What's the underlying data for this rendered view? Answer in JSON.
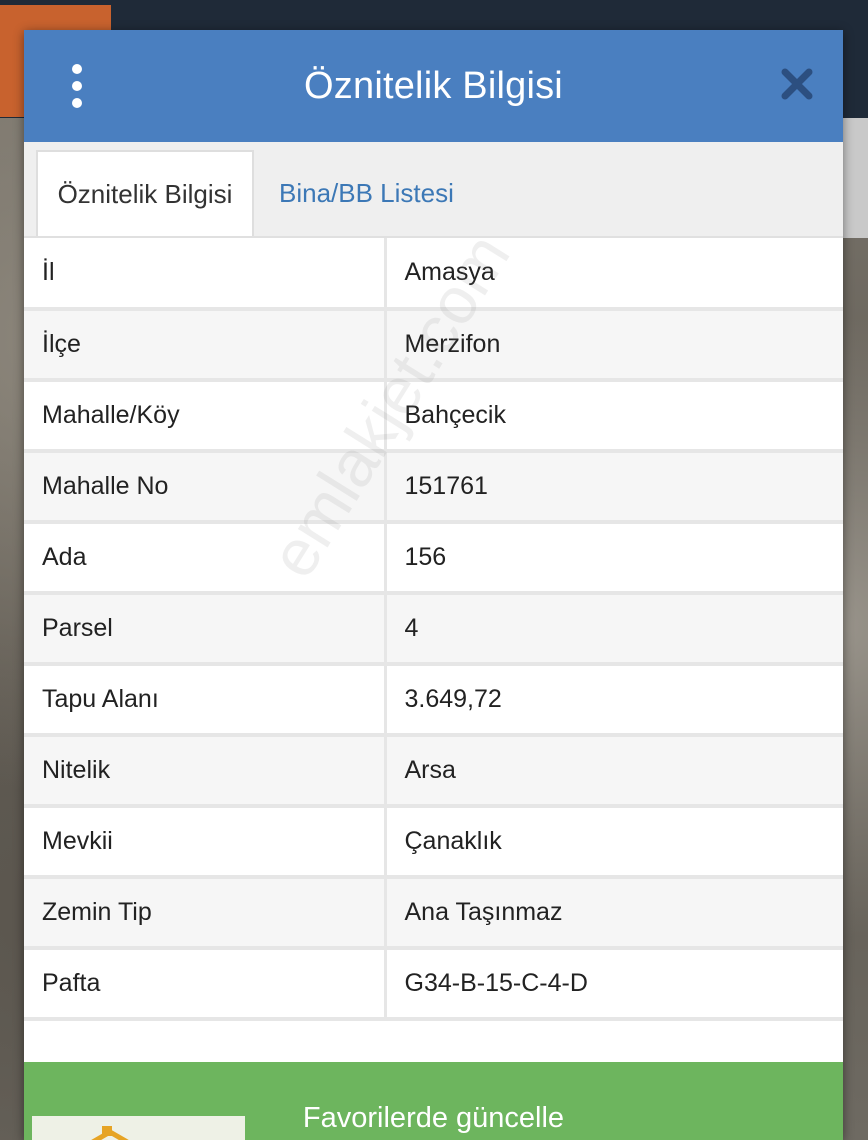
{
  "dialog": {
    "title": "Öznitelik Bilgisi",
    "menu_icon": "kebab-menu-icon",
    "close_icon": "close-icon"
  },
  "tabs": [
    {
      "label": "Öznitelik Bilgisi",
      "active": true
    },
    {
      "label": "Bina/BB Listesi",
      "active": false
    }
  ],
  "attributes": [
    {
      "key": "İl",
      "value": "Amasya"
    },
    {
      "key": "İlçe",
      "value": "Merzifon"
    },
    {
      "key": "Mahalle/Köy",
      "value": "Bahçecik"
    },
    {
      "key": "Mahalle No",
      "value": "151761"
    },
    {
      "key": "Ada",
      "value": "156"
    },
    {
      "key": "Parsel",
      "value": "4"
    },
    {
      "key": "Tapu Alanı",
      "value": "3.649,72"
    },
    {
      "key": "Nitelik",
      "value": "Arsa"
    },
    {
      "key": "Mevkii",
      "value": "Çanaklık"
    },
    {
      "key": "Zemin Tip",
      "value": "Ana Taşınmaz"
    },
    {
      "key": "Pafta",
      "value": "G34-B-15-C-4-D"
    }
  ],
  "actions": {
    "favorites_label": "Favorilerde güncelle"
  },
  "watermark": "emlakjet.com",
  "colors": {
    "header": "#4a7fc0",
    "tab_link": "#3c78b6",
    "action_button": "#6db55e"
  }
}
